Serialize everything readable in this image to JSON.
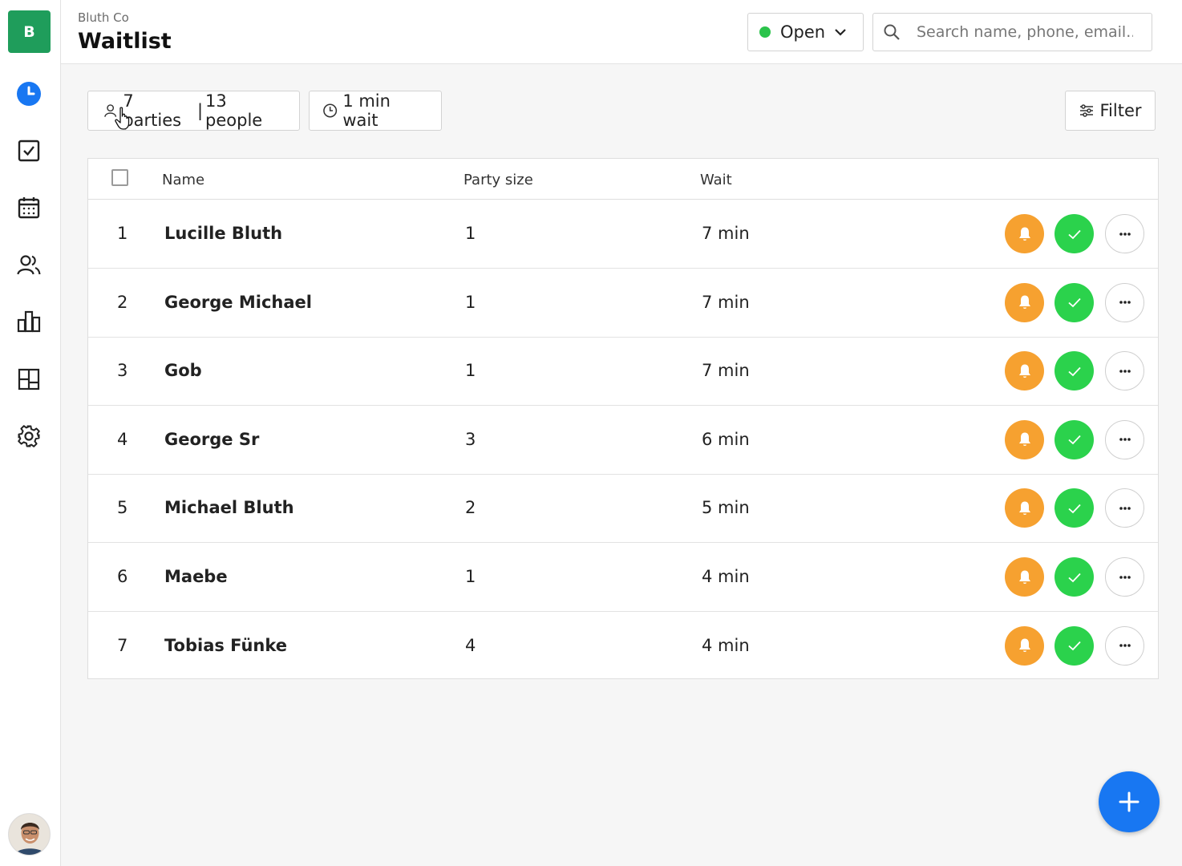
{
  "brand": {
    "initial": "B"
  },
  "header": {
    "org_name": "Bluth Co",
    "page_title": "Waitlist",
    "status": {
      "label": "Open",
      "color": "#2bc34b"
    },
    "search": {
      "placeholder": "Search name, phone, email.."
    }
  },
  "summary": {
    "parties": "7 parties",
    "separator": "|",
    "people": "13 people",
    "wait": "1 min wait",
    "filter_label": "Filter"
  },
  "table": {
    "columns": {
      "name": "Name",
      "party_size": "Party size",
      "wait": "Wait"
    },
    "rows": [
      {
        "num": "1",
        "name": "Lucille Bluth",
        "size": "1",
        "wait": "7 min"
      },
      {
        "num": "2",
        "name": "George Michael",
        "size": "1",
        "wait": "7 min"
      },
      {
        "num": "3",
        "name": "Gob",
        "size": "1",
        "wait": "7 min"
      },
      {
        "num": "4",
        "name": "George Sr",
        "size": "3",
        "wait": "6 min"
      },
      {
        "num": "5",
        "name": "Michael Bluth",
        "size": "2",
        "wait": "5 min"
      },
      {
        "num": "6",
        "name": "Maebe",
        "size": "1",
        "wait": "4 min"
      },
      {
        "num": "7",
        "name": "Tobias Fünke",
        "size": "4",
        "wait": "4 min"
      }
    ]
  },
  "colors": {
    "brand": "#1f9d5b",
    "notify": "#f6a130",
    "seat": "#2bd24c",
    "accent": "#1877f2"
  },
  "icons": {
    "sidebar": [
      "clock-icon",
      "checkbox-icon",
      "calendar-icon",
      "users-icon",
      "bar-chart-icon",
      "layout-icon",
      "gear-icon"
    ],
    "row_actions": [
      "bell-icon",
      "check-icon",
      "more-icon"
    ],
    "fab": "plus-icon"
  }
}
